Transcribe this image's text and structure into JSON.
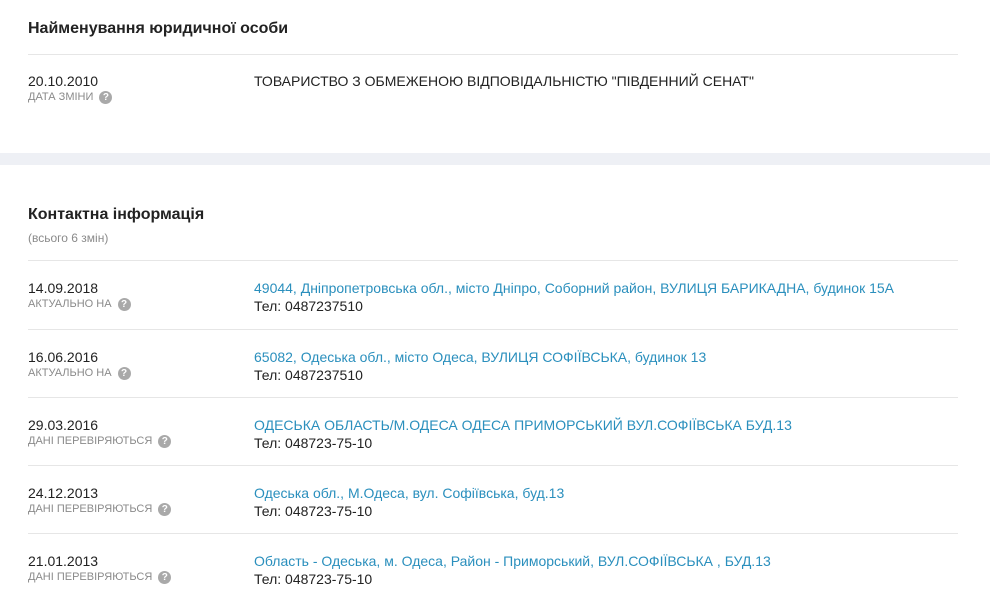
{
  "legal_name": {
    "title": "Найменування юридичної особи",
    "date": "20.10.2010",
    "date_label": "ДАТА ЗМІНИ",
    "value": "ТОВАРИСТВО З ОБМЕЖЕНОЮ ВІДПОВІДАЛЬНІСТЮ \"ПІВДЕННИЙ СЕНАТ\""
  },
  "contacts": {
    "title": "Контактна інформація",
    "subtitle": "(всього 6 змін)",
    "rows": [
      {
        "date": "14.09.2018",
        "label": "АКТУАЛЬНО НА",
        "address": "49044, Дніпропетровська обл., місто Дніпро, Соборний район, ВУЛИЦЯ БАРИКАДНА, будинок 15А",
        "phone": "Тел: 0487237510"
      },
      {
        "date": "16.06.2016",
        "label": "АКТУАЛЬНО НА",
        "address": "65082, Одеська обл., місто Одеса, ВУЛИЦЯ СОФІЇВСЬКА, будинок 13",
        "phone": "Тел: 0487237510"
      },
      {
        "date": "29.03.2016",
        "label": "ДАНІ ПЕРЕВІРЯЮТЬСЯ",
        "address": "ОДЕСЬКА ОБЛАСТЬ/М.ОДЕСА ОДЕСА ПРИМОРСЬКИЙ ВУЛ.СОФІЇВСЬКА БУД.13",
        "phone": "Тел: 048723-75-10"
      },
      {
        "date": "24.12.2013",
        "label": "ДАНІ ПЕРЕВІРЯЮТЬСЯ",
        "address": "Одеська обл., М.Одеса, вул. Софіївська, буд.13",
        "phone": "Тел: 048723-75-10"
      },
      {
        "date": "21.01.2013",
        "label": "ДАНІ ПЕРЕВІРЯЮТЬСЯ",
        "address": "Область - Одеська, м. Одеса, Район - Приморський, ВУЛ.СОФІЇВСЬКА , БУД.13",
        "phone": "Тел: 048723-75-10"
      }
    ]
  },
  "help_icon_glyph": "?",
  "colors": {
    "link": "#2a8fbd",
    "muted": "#8a8a8a",
    "band": "#eef0f5"
  }
}
